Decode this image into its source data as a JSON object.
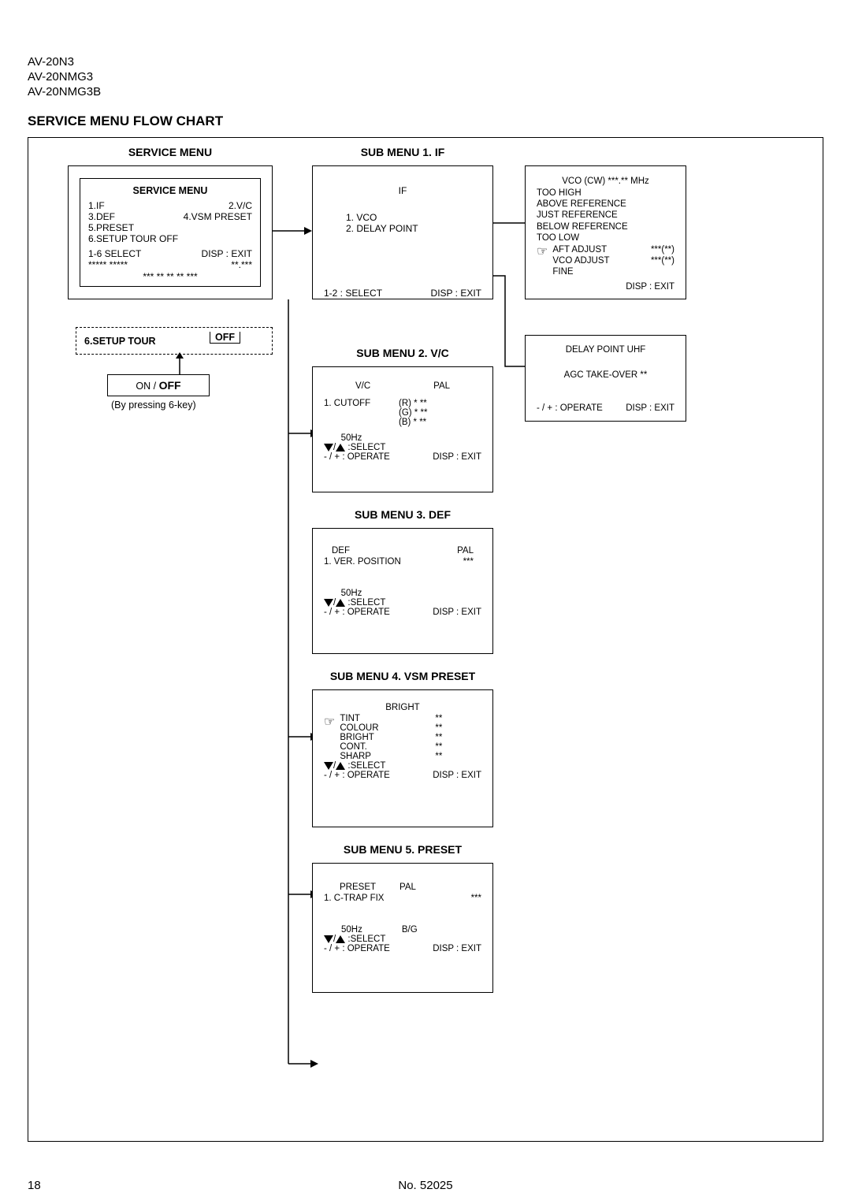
{
  "models": [
    "AV-20N3",
    "AV-20NMG3",
    "AV-20NMG3B"
  ],
  "title": "SERVICE MENU FLOW CHART",
  "service_menu": {
    "header": "SERVICE MENU",
    "inner_header": "SERVICE MENU",
    "items_left": [
      "1.IF",
      "3.DEF",
      "5.PRESET",
      "6.SETUP TOUR OFF"
    ],
    "items_right": [
      "2.V/C",
      "4.VSM PRESET"
    ],
    "row1_left": "1-6 SELECT",
    "row1_right": "DISP : EXIT",
    "row2_left": "***** *****",
    "row2_right": "**.***",
    "row3": "***  **  ** **  ***"
  },
  "tour": {
    "label": "6.SETUP TOUR",
    "off": "OFF"
  },
  "onoff": {
    "on": "ON",
    "sep": " / ",
    "off": "OFF"
  },
  "press_note": "(By pressing 6-key)",
  "sub1": {
    "title": "SUB MENU 1. IF",
    "header": "IF",
    "item1": "1. VCO",
    "item2": "2. DELAY POINT",
    "footer_left": "1-2 : SELECT",
    "footer_right": "DISP : EXIT"
  },
  "vco": {
    "l1": "VCO (CW)   ***.** MHz",
    "l2": "TOO HIGH",
    "l3": "ABOVE REFERENCE",
    "l4": "JUST REFERENCE",
    "l5": "BELOW REFERENCE",
    "l6": "TOO LOW",
    "aft": "AFT ADJUST",
    "aft_v": "***(**)",
    "vcoa": "VCO ADJUST",
    "vcoa_v": "***(**)",
    "fine": "FINE",
    "exit": "DISP : EXIT"
  },
  "delay": {
    "l1": "DELAY POINT    UHF",
    "l2": "AGC TAKE-OVER   **",
    "op": "- / + : OPERATE",
    "exit": "DISP : EXIT"
  },
  "sub2": {
    "title": "SUB MENU 2. V/C",
    "hdr_l": "V/C",
    "hdr_r": "PAL",
    "item": "1. CUTOFF",
    "r": "(R) * **",
    "g": "(G) * **",
    "b": "(B) * **",
    "hz": "50Hz",
    "sel": ":SELECT",
    "op": "- / + : OPERATE",
    "exit": "DISP : EXIT"
  },
  "sub3": {
    "title": "SUB MENU 3. DEF",
    "hdr_l": "DEF",
    "hdr_r": "PAL",
    "item": "1. VER. POSITION",
    "val": "***",
    "hz": "50Hz",
    "sel": ":SELECT",
    "op": "- / + : OPERATE",
    "exit": "DISP : EXIT"
  },
  "sub4": {
    "title": "SUB MENU 4. VSM PRESET",
    "hdr": "BRIGHT",
    "rows": [
      {
        "l": "TINT",
        "v": "**"
      },
      {
        "l": "COLOUR",
        "v": "**"
      },
      {
        "l": "BRIGHT",
        "v": "**"
      },
      {
        "l": "CONT.",
        "v": "**"
      },
      {
        "l": "SHARP",
        "v": "**"
      }
    ],
    "sel": ":SELECT",
    "op": "- / + : OPERATE",
    "exit": "DISP : EXIT"
  },
  "sub5": {
    "title": "SUB MENU 5. PRESET",
    "hdr_l": "PRESET",
    "hdr_r": "PAL",
    "item": "1. C-TRAP FIX",
    "val": "***",
    "hz": "50Hz",
    "bg": "B/G",
    "sel": ":SELECT",
    "op": "- / + : OPERATE",
    "exit": "DISP : EXIT"
  },
  "footer": {
    "page": "18",
    "doc": "No. 52025"
  }
}
